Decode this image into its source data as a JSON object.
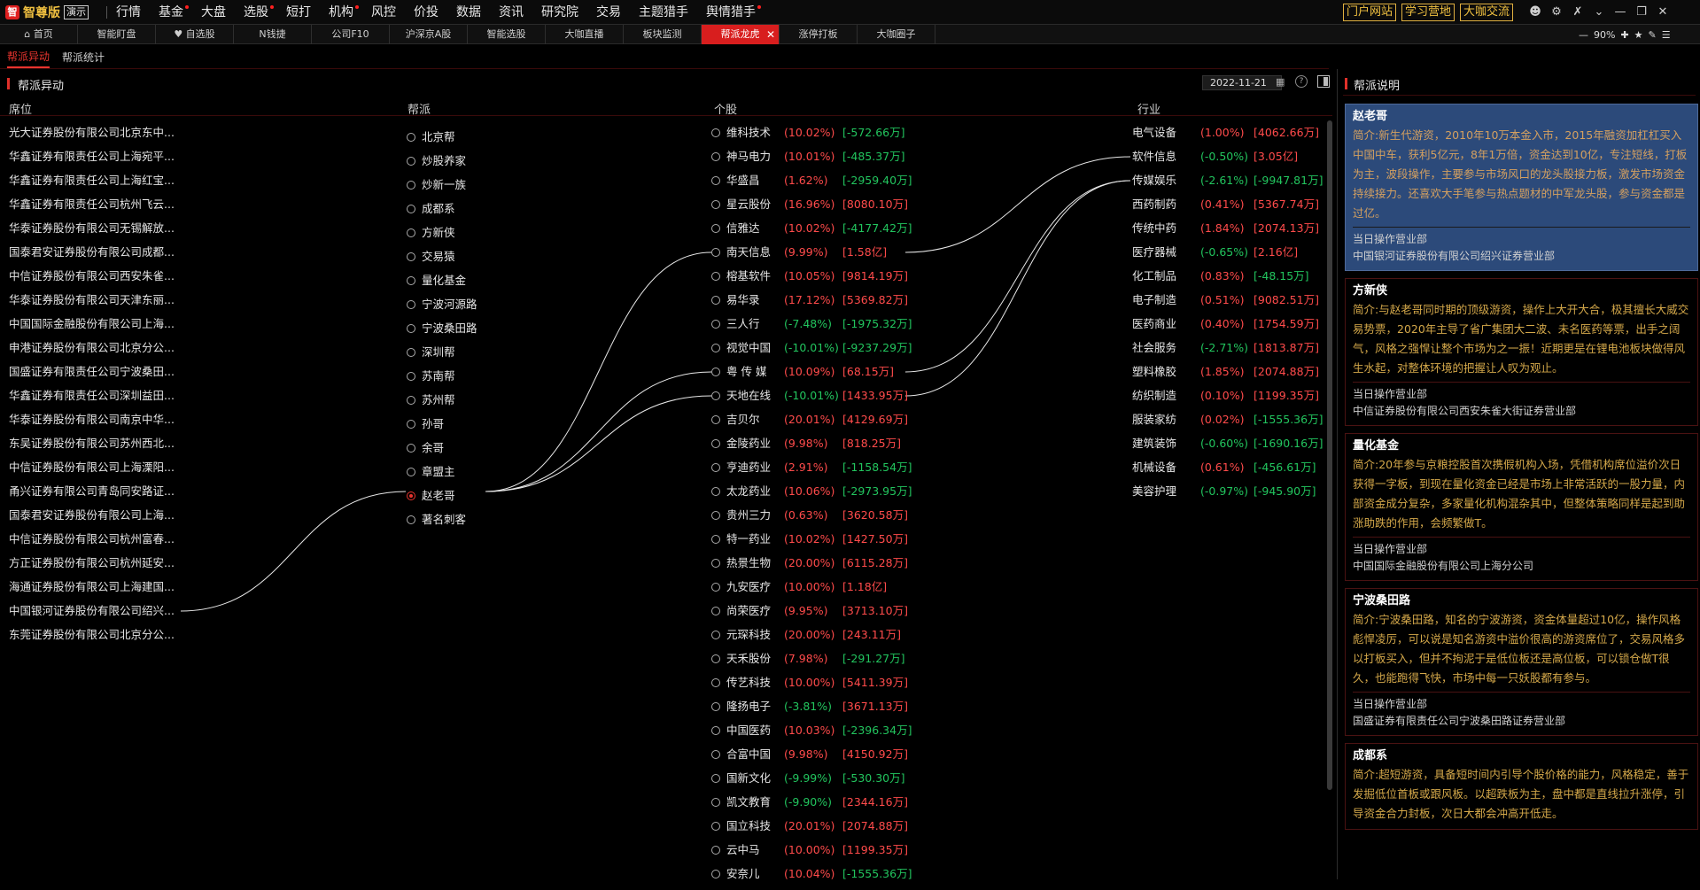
{
  "app": {
    "name": "智尊版",
    "edition": "演示"
  },
  "menu": [
    {
      "label": "行情",
      "dot": false
    },
    {
      "label": "基金",
      "dot": true
    },
    {
      "label": "大盘",
      "dot": false
    },
    {
      "label": "选股",
      "dot": true
    },
    {
      "label": "短打",
      "dot": false
    },
    {
      "label": "机构",
      "dot": true
    },
    {
      "label": "风控",
      "dot": false
    },
    {
      "label": "价投",
      "dot": false
    },
    {
      "label": "数据",
      "dot": false
    },
    {
      "label": "资讯",
      "dot": false
    },
    {
      "label": "研究院",
      "dot": false
    },
    {
      "label": "交易",
      "dot": false
    },
    {
      "label": "主题猎手",
      "dot": false
    },
    {
      "label": "舆情猎手",
      "dot": true
    }
  ],
  "top_links": [
    "门户网站",
    "学习营地",
    "大咖交流"
  ],
  "tabs": [
    {
      "label": "首页",
      "icon": "home-icon",
      "active": false
    },
    {
      "label": "智能盯盘",
      "active": false
    },
    {
      "label": "自选股",
      "icon": "heart-icon",
      "active": false
    },
    {
      "label": "N钱捷",
      "active": false
    },
    {
      "label": "公司F10",
      "active": false
    },
    {
      "label": "沪深京A股",
      "active": false
    },
    {
      "label": "智能选股",
      "active": false
    },
    {
      "label": "大咖直播",
      "active": false
    },
    {
      "label": "板块监测",
      "active": false
    },
    {
      "label": "帮派龙虎",
      "active": true
    },
    {
      "label": "涨停打板",
      "active": false
    },
    {
      "label": "大咖圈子",
      "active": false
    }
  ],
  "zoom": "90%",
  "subtabs": [
    {
      "label": "帮派异动",
      "active": true
    },
    {
      "label": "帮派统计",
      "active": false
    }
  ],
  "panel": {
    "title": "帮派异动",
    "date": "2022-11-21"
  },
  "columns": {
    "seat": "席位",
    "gang": "帮派",
    "stock": "个股",
    "industry": "行业"
  },
  "seats": [
    "光大证券股份有限公司北京东中...",
    "华鑫证券有限责任公司上海宛平...",
    "华鑫证券有限责任公司上海红宝...",
    "华鑫证券有限责任公司杭州飞云...",
    "华泰证券股份有限公司无锡解放...",
    "国泰君安证券股份有限公司成都...",
    "中信证券股份有限公司西安朱雀...",
    "华泰证券股份有限公司天津东丽...",
    "中国国际金融股份有限公司上海...",
    "申港证券股份有限公司北京分公...",
    "国盛证券有限责任公司宁波桑田...",
    "华鑫证券有限责任公司深圳益田...",
    "华泰证券股份有限公司南京中华...",
    "东吴证券股份有限公司苏州西北...",
    "中信证券股份有限公司上海溧阳...",
    "甬兴证券有限公司青岛同安路证...",
    "国泰君安证券股份有限公司上海...",
    "中信证券股份有限公司杭州富春...",
    "方正证券股份有限公司杭州延安...",
    "海通证券股份有限公司上海建国...",
    "中国银河证券股份有限公司绍兴...",
    "东莞证券股份有限公司北京分公..."
  ],
  "gangs": [
    {
      "name": "北京帮",
      "selected": false
    },
    {
      "name": "炒股养家",
      "selected": false
    },
    {
      "name": "炒新一族",
      "selected": false
    },
    {
      "name": "成都系",
      "selected": false
    },
    {
      "name": "方新侠",
      "selected": false
    },
    {
      "name": "交易猿",
      "selected": false
    },
    {
      "name": "量化基金",
      "selected": false
    },
    {
      "name": "宁波河源路",
      "selected": false
    },
    {
      "name": "宁波桑田路",
      "selected": false
    },
    {
      "name": "深圳帮",
      "selected": false
    },
    {
      "name": "苏南帮",
      "selected": false
    },
    {
      "name": "苏州帮",
      "selected": false
    },
    {
      "name": "孙哥",
      "selected": false
    },
    {
      "name": "余哥",
      "selected": false
    },
    {
      "name": "章盟主",
      "selected": false
    },
    {
      "name": "赵老哥",
      "selected": true
    },
    {
      "name": "著名刺客",
      "selected": false
    }
  ],
  "stocks": [
    {
      "name": "维科技术",
      "pct": "(10.02%)",
      "amt": "[-572.66万]",
      "pct_up": true,
      "amt_up": false
    },
    {
      "name": "神马电力",
      "pct": "(10.01%)",
      "amt": "[-485.37万]",
      "pct_up": true,
      "amt_up": false
    },
    {
      "name": "华盛昌",
      "pct": "(1.62%)",
      "amt": "[-2959.40万]",
      "pct_up": true,
      "amt_up": false
    },
    {
      "name": "星云股份",
      "pct": "(16.96%)",
      "amt": "[8080.10万]",
      "pct_up": true,
      "amt_up": true
    },
    {
      "name": "信雅达",
      "pct": "(10.02%)",
      "amt": "[-4177.42万]",
      "pct_up": true,
      "amt_up": false
    },
    {
      "name": "南天信息",
      "pct": "(9.99%)",
      "amt": "[1.58亿]",
      "pct_up": true,
      "amt_up": true
    },
    {
      "name": "榕基软件",
      "pct": "(10.05%)",
      "amt": "[9814.19万]",
      "pct_up": true,
      "amt_up": true
    },
    {
      "name": "易华录",
      "pct": "(17.12%)",
      "amt": "[5369.82万]",
      "pct_up": true,
      "amt_up": true
    },
    {
      "name": "三人行",
      "pct": "(-7.48%)",
      "amt": "[-1975.32万]",
      "pct_up": false,
      "amt_up": false
    },
    {
      "name": "视觉中国",
      "pct": "(-10.01%)",
      "amt": "[-9237.29万]",
      "pct_up": false,
      "amt_up": false
    },
    {
      "name": "粤 传 媒",
      "pct": "(10.09%)",
      "amt": "[68.15万]",
      "pct_up": true,
      "amt_up": true
    },
    {
      "name": "天地在线",
      "pct": "(-10.01%)",
      "amt": "[1433.95万]",
      "pct_up": false,
      "amt_up": true
    },
    {
      "name": "吉贝尔",
      "pct": "(20.01%)",
      "amt": "[4129.69万]",
      "pct_up": true,
      "amt_up": true
    },
    {
      "name": "金陵药业",
      "pct": "(9.98%)",
      "amt": "[818.25万]",
      "pct_up": true,
      "amt_up": true
    },
    {
      "name": "亨迪药业",
      "pct": "(2.91%)",
      "amt": "[-1158.54万]",
      "pct_up": true,
      "amt_up": false
    },
    {
      "name": "太龙药业",
      "pct": "(10.06%)",
      "amt": "[-2973.95万]",
      "pct_up": true,
      "amt_up": false
    },
    {
      "name": "贵州三力",
      "pct": "(0.63%)",
      "amt": "[3620.58万]",
      "pct_up": true,
      "amt_up": true
    },
    {
      "name": "特一药业",
      "pct": "(10.02%)",
      "amt": "[1427.50万]",
      "pct_up": true,
      "amt_up": true
    },
    {
      "name": "热景生物",
      "pct": "(20.00%)",
      "amt": "[6115.28万]",
      "pct_up": true,
      "amt_up": true
    },
    {
      "name": "九安医疗",
      "pct": "(10.00%)",
      "amt": "[1.18亿]",
      "pct_up": true,
      "amt_up": true
    },
    {
      "name": "尚荣医疗",
      "pct": "(9.95%)",
      "amt": "[3713.10万]",
      "pct_up": true,
      "amt_up": true
    },
    {
      "name": "元琛科技",
      "pct": "(20.00%)",
      "amt": "[243.11万]",
      "pct_up": true,
      "amt_up": true
    },
    {
      "name": "天禾股份",
      "pct": "(7.98%)",
      "amt": "[-291.27万]",
      "pct_up": true,
      "amt_up": false
    },
    {
      "name": "传艺科技",
      "pct": "(10.00%)",
      "amt": "[5411.39万]",
      "pct_up": true,
      "amt_up": true
    },
    {
      "name": "隆扬电子",
      "pct": "(-3.81%)",
      "amt": "[3671.13万]",
      "pct_up": false,
      "amt_up": true
    },
    {
      "name": "中国医药",
      "pct": "(10.03%)",
      "amt": "[-2396.34万]",
      "pct_up": true,
      "amt_up": false
    },
    {
      "name": "合富中国",
      "pct": "(9.98%)",
      "amt": "[4150.92万]",
      "pct_up": true,
      "amt_up": true
    },
    {
      "name": "国新文化",
      "pct": "(-9.99%)",
      "amt": "[-530.30万]",
      "pct_up": false,
      "amt_up": false
    },
    {
      "name": "凯文教育",
      "pct": "(-9.90%)",
      "amt": "[2344.16万]",
      "pct_up": false,
      "amt_up": true
    },
    {
      "name": "国立科技",
      "pct": "(20.01%)",
      "amt": "[2074.88万]",
      "pct_up": true,
      "amt_up": true
    },
    {
      "name": "云中马",
      "pct": "(10.00%)",
      "amt": "[1199.35万]",
      "pct_up": true,
      "amt_up": true
    },
    {
      "name": "安奈儿",
      "pct": "(10.04%)",
      "amt": "[-1555.36万]",
      "pct_up": true,
      "amt_up": false
    }
  ],
  "industries": [
    {
      "name": "电气设备",
      "pct": "(1.00%)",
      "amt": "[4062.66万]",
      "pct_up": true,
      "amt_up": true
    },
    {
      "name": "软件信息",
      "pct": "(-0.50%)",
      "amt": "[3.05亿]",
      "pct_up": false,
      "amt_up": true
    },
    {
      "name": "传媒娱乐",
      "pct": "(-2.61%)",
      "amt": "[-9947.81万]",
      "pct_up": false,
      "amt_up": false
    },
    {
      "name": "西药制药",
      "pct": "(0.41%)",
      "amt": "[5367.74万]",
      "pct_up": true,
      "amt_up": true
    },
    {
      "name": "传统中药",
      "pct": "(1.84%)",
      "amt": "[2074.13万]",
      "pct_up": true,
      "amt_up": true
    },
    {
      "name": "医疗器械",
      "pct": "(-0.65%)",
      "amt": "[2.16亿]",
      "pct_up": false,
      "amt_up": true
    },
    {
      "name": "化工制品",
      "pct": "(0.83%)",
      "amt": "[-48.15万]",
      "pct_up": true,
      "amt_up": false
    },
    {
      "name": "电子制造",
      "pct": "(0.51%)",
      "amt": "[9082.51万]",
      "pct_up": true,
      "amt_up": true
    },
    {
      "name": "医药商业",
      "pct": "(0.40%)",
      "amt": "[1754.59万]",
      "pct_up": true,
      "amt_up": true
    },
    {
      "name": "社会服务",
      "pct": "(-2.71%)",
      "amt": "[1813.87万]",
      "pct_up": false,
      "amt_up": true
    },
    {
      "name": "塑料橡胶",
      "pct": "(1.85%)",
      "amt": "[2074.88万]",
      "pct_up": true,
      "amt_up": true
    },
    {
      "name": "纺织制造",
      "pct": "(0.10%)",
      "amt": "[1199.35万]",
      "pct_up": true,
      "amt_up": true
    },
    {
      "name": "服装家纺",
      "pct": "(0.02%)",
      "amt": "[-1555.36万]",
      "pct_up": true,
      "amt_up": false
    },
    {
      "name": "建筑装饰",
      "pct": "(-0.60%)",
      "amt": "[-1690.16万]",
      "pct_up": false,
      "amt_up": false
    },
    {
      "name": "机械设备",
      "pct": "(0.61%)",
      "amt": "[-456.61万]",
      "pct_up": true,
      "amt_up": false
    },
    {
      "name": "美容护理",
      "pct": "(-0.97%)",
      "amt": "[-945.90万]",
      "pct_up": false,
      "amt_up": false
    }
  ],
  "links": {
    "seat_to_gang": [
      {
        "seat": 20,
        "gang": 15
      }
    ],
    "gang_to_stock": [
      {
        "gang": 15,
        "stock": 5
      },
      {
        "gang": 15,
        "stock": 10
      },
      {
        "gang": 15,
        "stock": 11
      }
    ],
    "stock_to_industry": [
      {
        "stock": 5,
        "industry": 1
      },
      {
        "stock": 10,
        "industry": 2
      },
      {
        "stock": 11,
        "industry": 2
      }
    ]
  },
  "right_panel": {
    "title": "帮派说明",
    "day_label": "当日操作营业部",
    "cards": [
      {
        "name": "赵老哥",
        "selected": true,
        "desc": "简介:新生代游资，2010年10万本金入市，2015年融资加杠杠买入中国中车，获利5亿元，8年1万倍，资金达到10亿，专注短线，打板为主，波段操作，主要参与市场风口的龙头股接力板，激发市场资金持续接力。还喜欢大手笔参与热点题材的中军龙头股，参与资金都是过亿。",
        "branch": "中国银河证券股份有限公司绍兴证券营业部"
      },
      {
        "name": "方新侠",
        "selected": false,
        "desc": "简介:与赵老哥同时期的顶级游资，操作上大开大合，极其擅长大威交易势票，2020年主导了省广集团大二波、未名医药等票，出手之阔气，风格之强悍让整个市场为之一振！近期更是在锂电池板块做得风生水起，对整体环境的把握让人叹为观止。",
        "branch": "中信证券股份有限公司西安朱雀大街证券营业部"
      },
      {
        "name": "量化基金",
        "selected": false,
        "desc": "简介:20年参与京粮控股首次携假机构入场，凭借机构席位溢价次日获得一字板，到现在量化资金已经是市场上非常活跃的一股力量，内部资金成分复杂，多家量化机构混杂其中，但整体策略同样是起到助涨助跌的作用，会频繁做T。",
        "branch": "中国国际金融股份有限公司上海分公司"
      },
      {
        "name": "宁波桑田路",
        "selected": false,
        "desc": "简介:宁波桑田路，知名的宁波游资，资金体量超过10亿，操作风格彪悍凌厉，可以说是知名游资中溢价很高的游资席位了，交易风格多以打板买入，但并不拘泥于是低位板还是高位板，可以锁仓做T很久，也能跑得飞快，市场中每一只妖股都有参与。",
        "branch": "国盛证券有限责任公司宁波桑田路证券营业部"
      },
      {
        "name": "成都系",
        "selected": false,
        "desc": "简介:超短游资，具备短时间内引导个股价格的能力，风格稳定，善于发掘低位首板或跟风板。以超跌板为主，盘中都是直线拉升涨停，引导资金合力封板，次日大都会冲高开低走。",
        "branch": ""
      }
    ]
  }
}
